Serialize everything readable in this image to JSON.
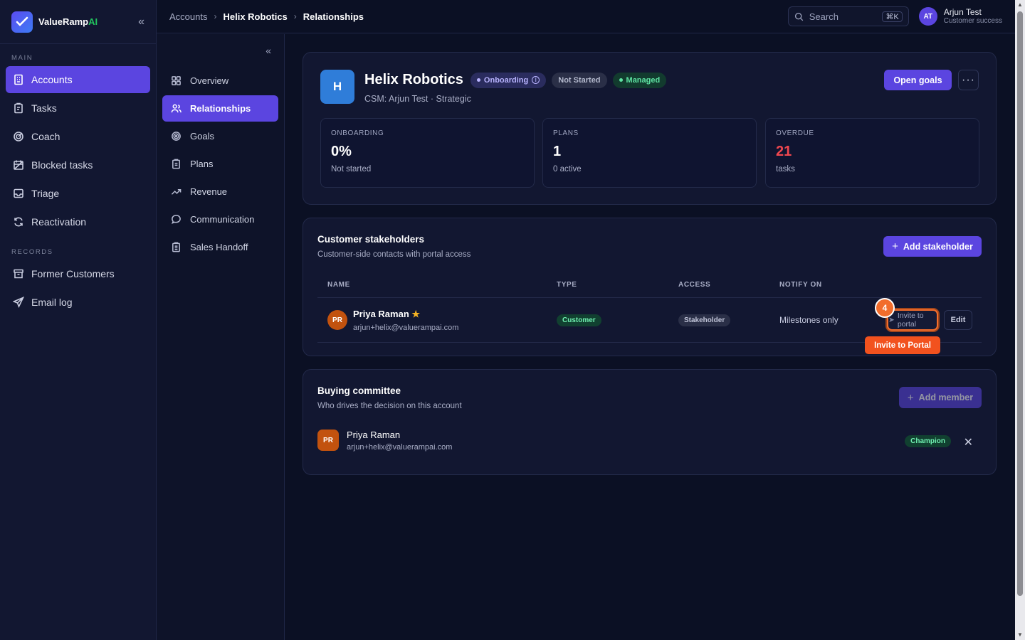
{
  "brand": {
    "name_main": "ValueRamp",
    "name_accent": "AI"
  },
  "sidebar": {
    "main_label": "MAIN",
    "records_label": "RECORDS",
    "main_items": [
      {
        "label": "Accounts",
        "icon": "building-icon",
        "active": true
      },
      {
        "label": "Tasks",
        "icon": "clipboard-icon"
      },
      {
        "label": "Coach",
        "icon": "target-icon"
      },
      {
        "label": "Blocked tasks",
        "icon": "calendar-off-icon"
      },
      {
        "label": "Triage",
        "icon": "inbox-icon"
      },
      {
        "label": "Reactivation",
        "icon": "refresh-icon"
      }
    ],
    "record_items": [
      {
        "label": "Former Customers",
        "icon": "archive-icon"
      },
      {
        "label": "Email log",
        "icon": "send-icon"
      }
    ]
  },
  "topbar": {
    "breadcrumb": [
      "Accounts",
      "Helix Robotics",
      "Relationships"
    ],
    "search_placeholder": "Search",
    "search_shortcut": "⌘K",
    "user": {
      "initials": "AT",
      "name": "Arjun Test",
      "role": "Customer success"
    }
  },
  "subnav": {
    "items": [
      {
        "label": "Overview",
        "icon": "grid-icon"
      },
      {
        "label": "Relationships",
        "icon": "users-icon",
        "active": true
      },
      {
        "label": "Goals",
        "icon": "target-icon"
      },
      {
        "label": "Plans",
        "icon": "clipboard-icon"
      },
      {
        "label": "Revenue",
        "icon": "trending-up-icon"
      },
      {
        "label": "Communication",
        "icon": "message-icon"
      },
      {
        "label": "Sales Handoff",
        "icon": "clipboard-list-icon"
      }
    ]
  },
  "account": {
    "logo_letter": "H",
    "name": "Helix Robotics",
    "status_pills": {
      "onboarding": "Onboarding",
      "not_started": "Not Started",
      "managed": "Managed"
    },
    "subtitle": "CSM: Arjun Test · Strategic",
    "open_goals_label": "Open goals",
    "more_label": "···",
    "stats": [
      {
        "label": "ONBOARDING",
        "value": "0%",
        "sub": "Not started"
      },
      {
        "label": "PLANS",
        "value": "1",
        "sub": "0 active"
      },
      {
        "label": "OVERDUE",
        "value": "21",
        "sub": "tasks"
      }
    ]
  },
  "stakeholders": {
    "title": "Customer stakeholders",
    "subtitle": "Customer-side contacts with portal access",
    "add_label": "Add stakeholder",
    "columns": {
      "name": "NAME",
      "type": "TYPE",
      "access": "ACCESS",
      "notify": "NOTIFY ON"
    },
    "rows": [
      {
        "initials": "PR",
        "name": "Priya Raman",
        "email": "arjun+helix@valuerampai.com",
        "type": "Customer",
        "access": "Stakeholder",
        "notify": "Milestones only",
        "invite_label": "Invite to portal",
        "edit_label": "Edit"
      }
    ],
    "step_badge": "4",
    "tooltip": "Invite to Portal"
  },
  "buying": {
    "title": "Buying committee",
    "subtitle": "Who drives the decision on this account",
    "add_label": "Add member",
    "member": {
      "initials": "PR",
      "name": "Priya Raman",
      "email": "arjun+helix@valuerampai.com",
      "role": "Champion"
    },
    "remove_label": "✕"
  },
  "colors": {
    "accent": "#5b45e0",
    "highlight": "#f26d2c",
    "danger": "#f0474f",
    "success": "#5ee3a2"
  }
}
